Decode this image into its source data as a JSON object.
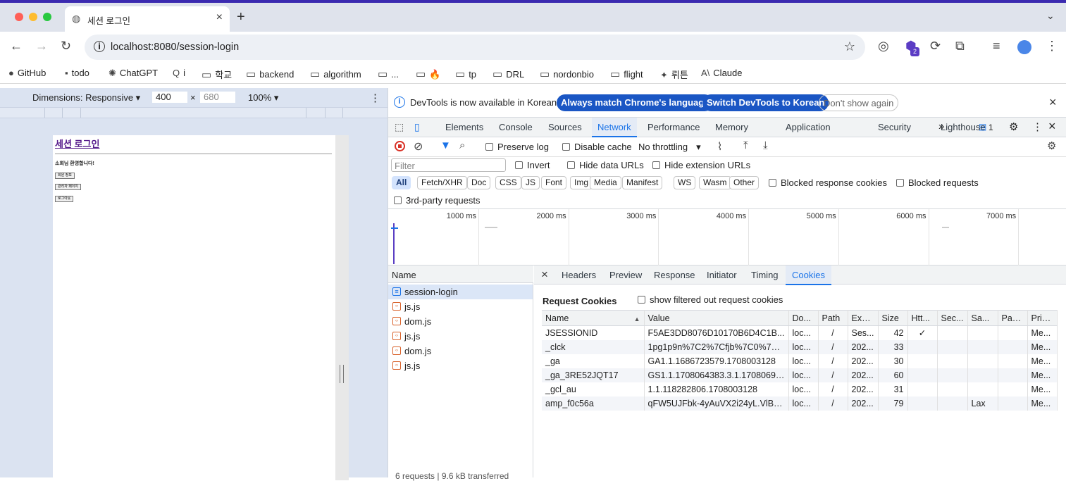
{
  "browser": {
    "tab_title": "세션 로그인",
    "url": "localhost:8080/session-login",
    "profile_badge": "2"
  },
  "bookmarks": [
    {
      "icon": "github-icon",
      "label": "GitHub"
    },
    {
      "icon": "todo-icon",
      "label": "todo"
    },
    {
      "icon": "chatgpt-icon",
      "label": "ChatGPT"
    },
    {
      "icon": "search-q-icon",
      "label": "i"
    },
    {
      "icon": "folder-icon",
      "label": "학교"
    },
    {
      "icon": "folder-icon",
      "label": "backend"
    },
    {
      "icon": "folder-icon",
      "label": "algorithm"
    },
    {
      "icon": "folder-icon",
      "label": "..."
    },
    {
      "icon": "folder-icon",
      "label": "🔥"
    },
    {
      "icon": "folder-icon",
      "label": "tp"
    },
    {
      "icon": "folder-icon",
      "label": "DRL"
    },
    {
      "icon": "folder-icon",
      "label": "nordonbio"
    },
    {
      "icon": "folder-icon",
      "label": "flight"
    },
    {
      "icon": "wetoon-icon",
      "label": "뤼튼"
    },
    {
      "icon": "claude-icon",
      "label": "Claude"
    }
  ],
  "device_toolbar": {
    "dimensions_label": "Dimensions: Responsive ▾",
    "width": "400",
    "times": "×",
    "height": "680",
    "zoom": "100% ▾"
  },
  "preview": {
    "heading": "세션 로그인",
    "welcome": "소희님 환영합니다!",
    "buttons": [
      "회원 정보",
      "관리자 페이지",
      "로그아웃"
    ]
  },
  "infobar": {
    "message": "DevTools is now available in Korean!",
    "btn_match": "Always match Chrome's language",
    "btn_switch": "Switch DevTools to Korean",
    "btn_dont": "Don't show again"
  },
  "devtools_tabs": [
    "Elements",
    "Console",
    "Sources",
    "Network",
    "Performance",
    "Memory",
    "Application",
    "Security",
    "Lighthouse"
  ],
  "active_tab": "Network",
  "more_tabs": "»",
  "issues_count": "1",
  "network_toolbar": {
    "preserve_log": "Preserve log",
    "disable_cache": "Disable cache",
    "throttling": "No throttling"
  },
  "filter": {
    "placeholder": "Filter",
    "invert": "Invert",
    "hide_data": "Hide data URLs",
    "hide_ext": "Hide extension URLs"
  },
  "type_chips": [
    "All",
    "Fetch/XHR",
    "Doc",
    "CSS",
    "JS",
    "Font",
    "Img",
    "Media",
    "Manifest",
    "WS",
    "Wasm",
    "Other"
  ],
  "blocked_cookies": "Blocked response cookies",
  "blocked_requests": "Blocked requests",
  "third_party": "3rd-party requests",
  "timeline_labels": [
    "1000 ms",
    "2000 ms",
    "3000 ms",
    "4000 ms",
    "5000 ms",
    "6000 ms",
    "7000 ms"
  ],
  "requests": {
    "header": "Name",
    "items": [
      {
        "name": "session-login",
        "type": "doc"
      },
      {
        "name": "js.js",
        "type": "script"
      },
      {
        "name": "dom.js",
        "type": "script"
      },
      {
        "name": "js.js",
        "type": "script"
      },
      {
        "name": "dom.js",
        "type": "script"
      },
      {
        "name": "js.js",
        "type": "script"
      }
    ],
    "footer": "6 requests | 9.6 kB transferred"
  },
  "detail_tabs": [
    "Headers",
    "Preview",
    "Response",
    "Initiator",
    "Timing",
    "Cookies"
  ],
  "detail_active": "Cookies",
  "cookies": {
    "section_title": "Request Cookies",
    "show_filtered": "show filtered out request cookies",
    "columns": [
      "Name",
      "Value",
      "Do...",
      "Path",
      "Expi...",
      "Size",
      "Htt...",
      "Sec...",
      "Sa...",
      "Part...",
      "Prio..."
    ],
    "sort_indicator": "▲",
    "rows": [
      [
        "JSESSIONID",
        "F5AE3DD8076D10170B6D4C1B...",
        "loc...",
        "/",
        "Ses...",
        "42",
        "✓",
        "",
        "",
        "",
        "Me..."
      ],
      [
        "_clck",
        "1pg1p9n%7C2%7Cfjb%7C0%7C...",
        "loc...",
        "/",
        "202...",
        "33",
        "",
        "",
        "",
        "",
        "Me..."
      ],
      [
        "_ga",
        "GA1.1.1686723579.1708003128",
        "loc...",
        "/",
        "202...",
        "30",
        "",
        "",
        "",
        "",
        "Me..."
      ],
      [
        "_ga_3RE52JQT17",
        "GS1.1.1708064383.3.1.17080698...",
        "loc...",
        "/",
        "202...",
        "60",
        "",
        "",
        "",
        "",
        "Me..."
      ],
      [
        "_gcl_au",
        "1.1.118282806.1708003128",
        "loc...",
        "/",
        "202...",
        "31",
        "",
        "",
        "",
        "",
        "Me..."
      ],
      [
        "amp_f0c56a",
        "qFW5UJFbk-4yAuVX2i24yL.VlBH...",
        "loc...",
        "/",
        "202...",
        "79",
        "",
        "",
        "Lax",
        "",
        "Me..."
      ]
    ]
  },
  "colors": {
    "accent": "#1a73e8",
    "tab_strip": "#dfe3ec",
    "selected_row": "#dbe6f7"
  }
}
